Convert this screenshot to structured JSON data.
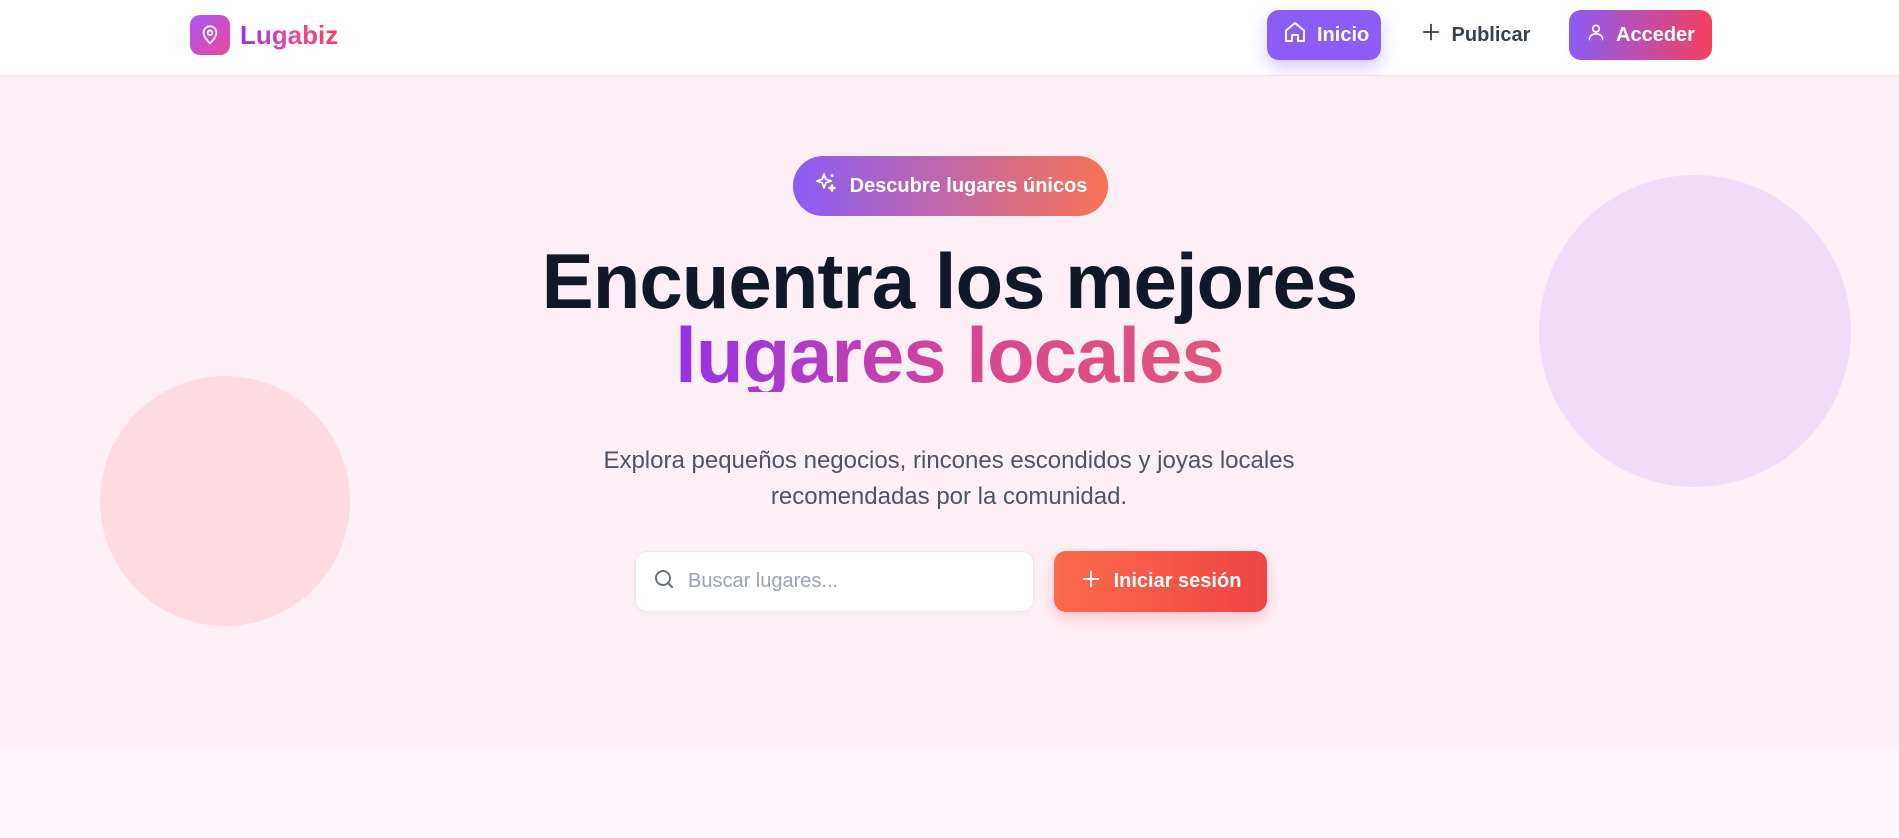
{
  "brand": {
    "name": "Lugabiz",
    "icon": "map-pin-icon"
  },
  "nav": {
    "home_label": "Inicio",
    "publish_label": "Publicar",
    "access_label": "Acceder"
  },
  "hero": {
    "badge_label": "Descubre lugares únicos",
    "title_line1": "Encuentra los mejores",
    "title_line2": "lugares locales",
    "subtitle": "Explora pequeños negocios, rincones escondidos y joyas locales recomendadas por la comunidad.",
    "search_placeholder": "Buscar lugares...",
    "search_value": "",
    "cta_label": "Iniciar sesión"
  },
  "colors": {
    "primary": "#8b5cf6",
    "accent": "#f43f5e",
    "cta": "#ef4444",
    "hero_bg": "#fcf0f6"
  }
}
